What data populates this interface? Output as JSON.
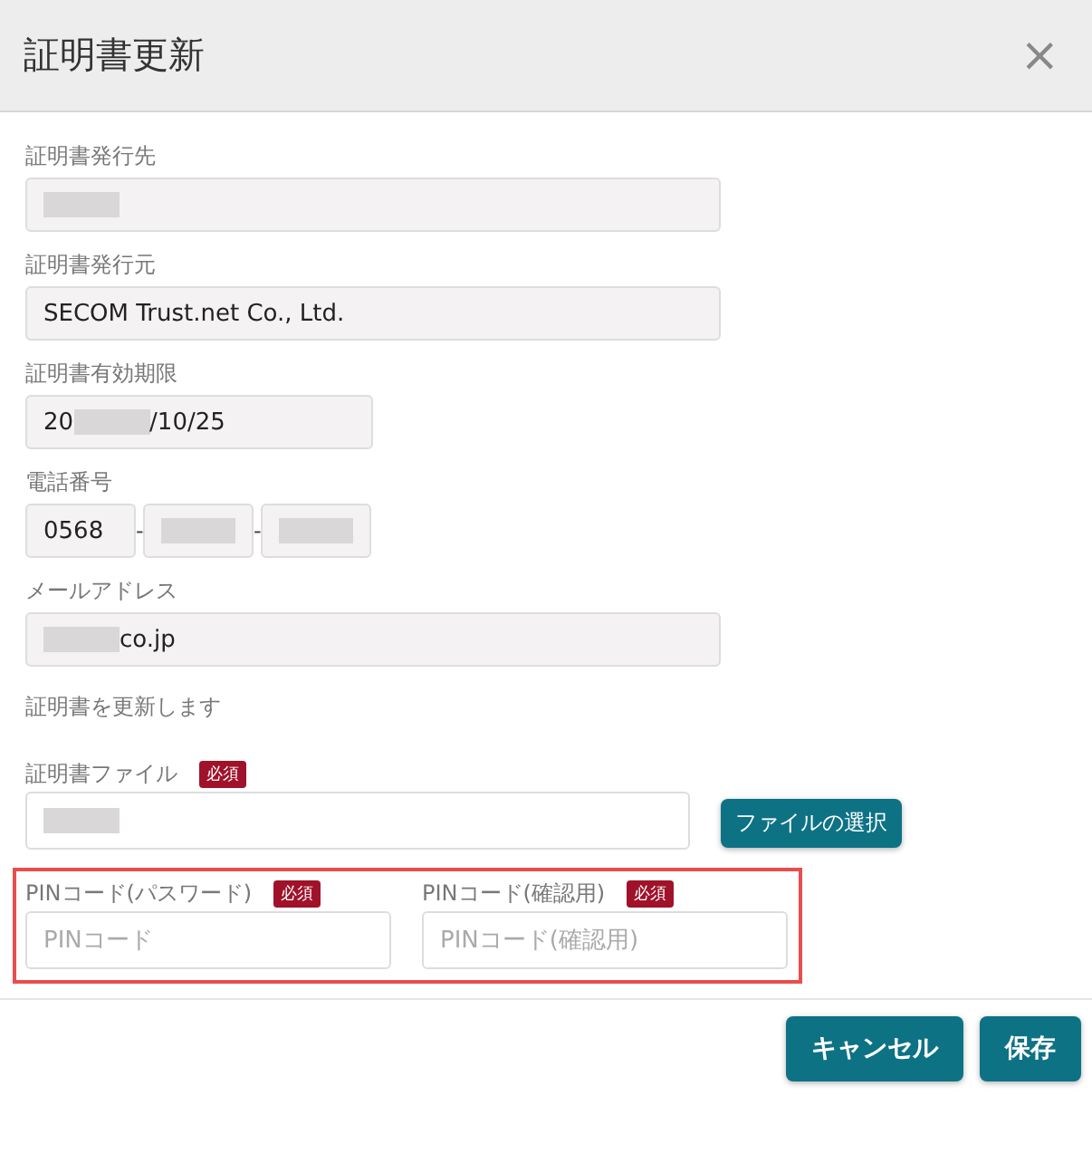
{
  "dialog": {
    "title": "証明書更新",
    "close": "×"
  },
  "fields": [
    {
      "kind": "wide",
      "label": "証明書発行先",
      "parts": [
        {
          "kind": "redacted"
        }
      ]
    },
    {
      "kind": "wide",
      "label": "証明書発行元",
      "parts": [
        {
          "kind": "text",
          "text": "SECOM Trust.net Co., Ltd."
        }
      ]
    },
    {
      "kind": "short",
      "label": "証明書有効期限",
      "parts": [
        {
          "kind": "text",
          "text": "20"
        },
        {
          "kind": "redacted"
        },
        {
          "kind": "text",
          "text": "/10/25"
        }
      ]
    },
    {
      "kind": "phone",
      "label": "電話番号",
      "segments": [
        {
          "parts": [
            {
              "kind": "text",
              "text": "0568"
            }
          ]
        },
        {
          "parts": [
            {
              "kind": "redacted"
            }
          ]
        },
        {
          "parts": [
            {
              "kind": "redacted"
            }
          ]
        }
      ],
      "separators": [
        "-",
        "-"
      ]
    },
    {
      "kind": "wide",
      "label": "メールアドレス",
      "parts": [
        {
          "kind": "redacted"
        },
        {
          "kind": "text",
          "text": "co.jp"
        }
      ]
    }
  ],
  "note": "証明書を更新します",
  "file": {
    "label": "証明書ファイル",
    "required": "必須",
    "parts": [
      {
        "kind": "redacted"
      }
    ],
    "button": "ファイルの選択"
  },
  "pin_fields": [
    {
      "label": "PINコード(パスワード)",
      "required": "必須",
      "placeholder": "PINコード"
    },
    {
      "label": "PINコード(確認用)",
      "required": "必須",
      "placeholder": "PINコード(確認用)"
    }
  ],
  "buttons": [
    {
      "label": "キャンセル"
    },
    {
      "label": "保存"
    }
  ]
}
